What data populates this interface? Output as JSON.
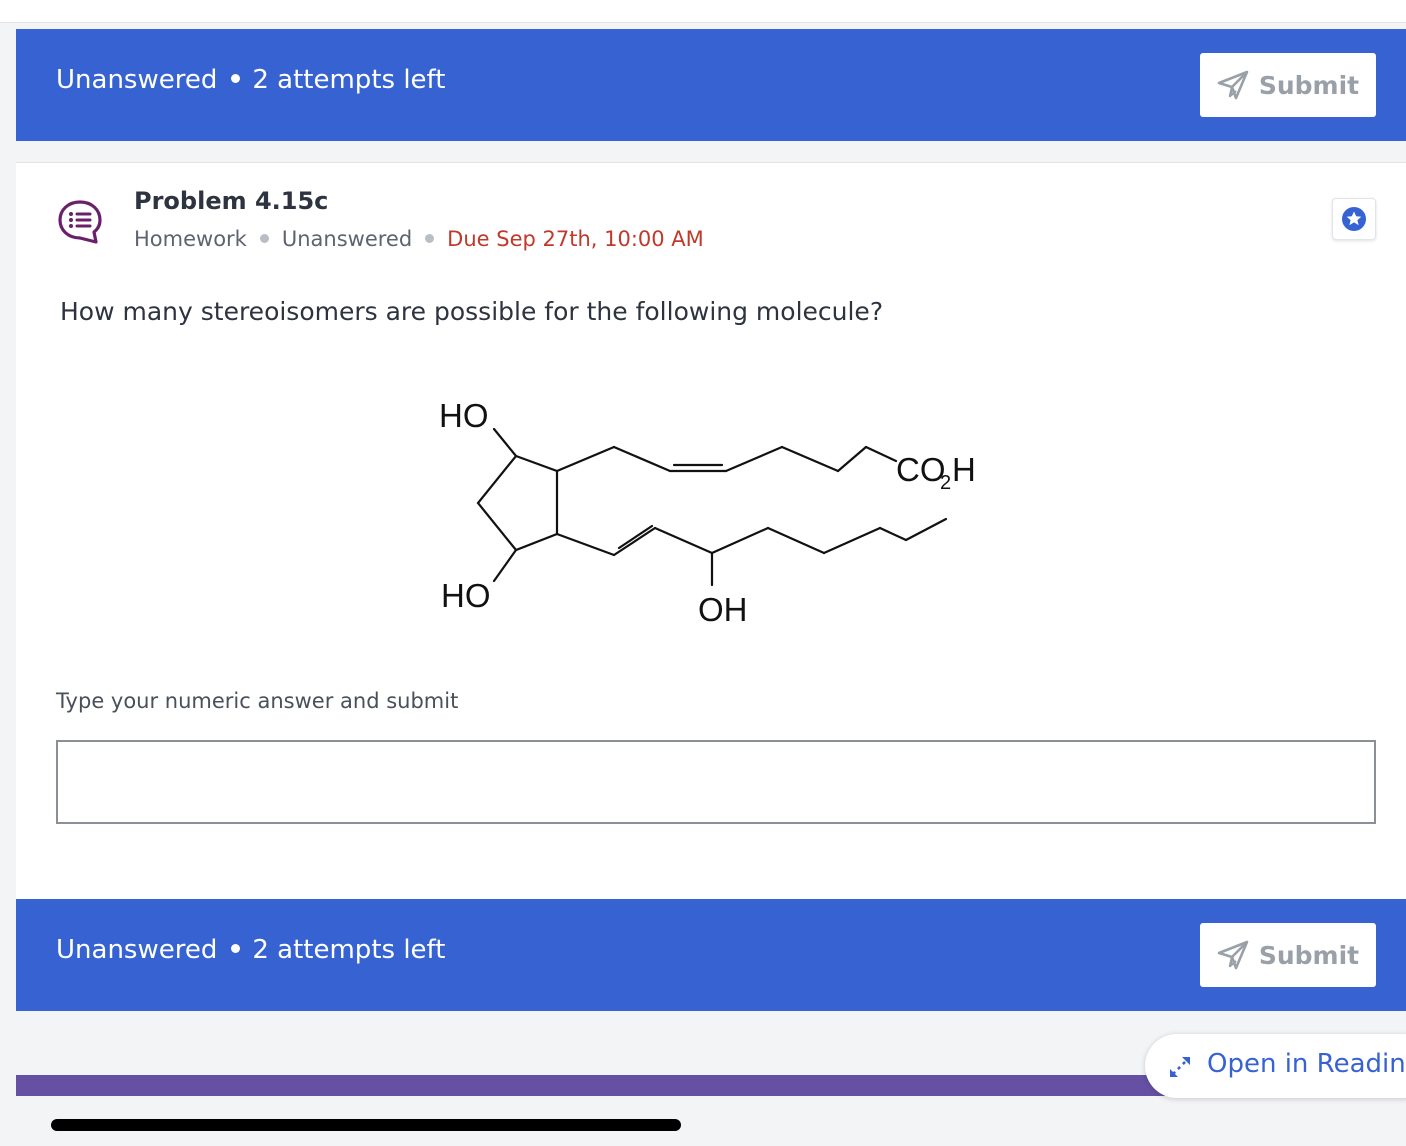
{
  "status": {
    "state": "Unanswered",
    "attempts": "2 attempts left",
    "submit_label": "Submit"
  },
  "problem": {
    "title": "Problem 4.15c",
    "type": "Homework",
    "state": "Unanswered",
    "due": "Due Sep 27th, 10:00 AM",
    "question": "How many stereoisomers are possible for the following molecule?",
    "molecule_labels": {
      "ho_top": "HO",
      "ho_bottom": "HO",
      "oh": "OH",
      "co2h_main": "CO",
      "co2h_sub": "2",
      "co2h_end": "H"
    },
    "answer_label": "Type your numeric answer and submit",
    "answer_value": ""
  },
  "footer": {
    "reading_label": "Open in Reading"
  },
  "icons": {
    "problem": "speech-bubble-list-icon",
    "star": "star-icon",
    "submit": "paper-plane-icon",
    "reading": "expand-arrows-icon"
  },
  "colors": {
    "brand_blue": "#3763d2",
    "due_red": "#c0392b",
    "purple": "#6650a4",
    "icon_purple": "#6b1f6b"
  }
}
